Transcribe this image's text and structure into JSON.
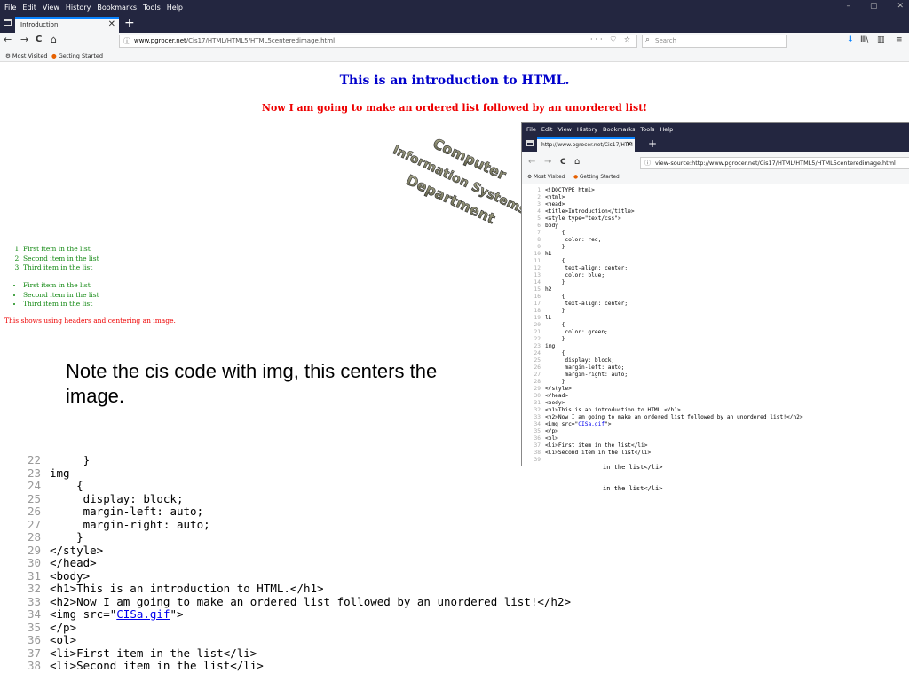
{
  "browser": {
    "menu": [
      "File",
      "Edit",
      "View",
      "History",
      "Bookmarks",
      "Tools",
      "Help"
    ],
    "window_controls": [
      "–",
      "▢",
      "✕"
    ],
    "tab": {
      "title": "Introduction",
      "close": "✕"
    },
    "new_tab": "+",
    "nav": {
      "back": "←",
      "forward": "→",
      "reload": "C",
      "home": "⌂"
    },
    "url_info_icon": "ⓘ",
    "url_domain": "www.pgrocer.net",
    "url_path": "/Cis17/HTML/HTML5/HTML5centeredimage.html",
    "url_actions": "··· ♡ ☆",
    "search_icon": "⌕",
    "search_placeholder": "Search",
    "toolbar_icons": {
      "download": "⬇",
      "library": "Ⅲ\\",
      "sidebar": "▥",
      "menu": "≡"
    },
    "bookmarks": [
      {
        "icon": "⚙",
        "label": "Most Visited"
      },
      {
        "icon": "●",
        "label": "Getting Started"
      }
    ]
  },
  "page": {
    "h1": "This is an introduction to HTML.",
    "h2": "Now I am going to make an ordered list followed by an unordered list!",
    "logo_text": [
      "Computer",
      "Information Systems",
      "Department"
    ],
    "ordered_list": [
      "First item in the list",
      "Second item in the list",
      "Third item in the list"
    ],
    "unordered_list": [
      "First item in the list",
      "Second item in the list",
      "Third item in the list"
    ],
    "paragraph": "This shows using headers and centering an image."
  },
  "note": "Note the cis code with img, this centers the image.",
  "source_window": {
    "menu": [
      "File",
      "Edit",
      "View",
      "History",
      "Bookmarks",
      "Tools",
      "Help"
    ],
    "tab": {
      "title": "http://www.pgrocer.net/Cis17/HTM",
      "close": "✕"
    },
    "new_tab": "+",
    "nav": {
      "back": "←",
      "forward": "→",
      "reload": "C",
      "home": "⌂"
    },
    "url_info_icon": "ⓘ",
    "url": "view-source:http://www.pgrocer.net/Cis17/HTML/HTML5/HTML5centeredimage.html",
    "bookmarks": [
      {
        "icon": "⚙",
        "label": "Most Visited"
      },
      {
        "icon": "●",
        "label": "Getting Started"
      }
    ],
    "lines": [
      {
        "n": "1",
        "t": "<!DOCTYPE html>"
      },
      {
        "n": "2",
        "t": "<html>"
      },
      {
        "n": "3",
        "t": "<head>"
      },
      {
        "n": "4",
        "t": "<title>Introduction</title>"
      },
      {
        "n": "5",
        "t": "<style type=\"text/css\">"
      },
      {
        "n": "6",
        "t": "body"
      },
      {
        "n": "7",
        "t": "     {"
      },
      {
        "n": "8",
        "t": "      color: red;"
      },
      {
        "n": "9",
        "t": "     }"
      },
      {
        "n": "10",
        "t": "h1"
      },
      {
        "n": "11",
        "t": "     {"
      },
      {
        "n": "12",
        "t": "      text-align: center;"
      },
      {
        "n": "13",
        "t": "      color: blue;"
      },
      {
        "n": "14",
        "t": "     }"
      },
      {
        "n": "15",
        "t": "h2"
      },
      {
        "n": "16",
        "t": "     {"
      },
      {
        "n": "17",
        "t": "      text-align: center;"
      },
      {
        "n": "18",
        "t": "     }"
      },
      {
        "n": "19",
        "t": "li"
      },
      {
        "n": "20",
        "t": "     {"
      },
      {
        "n": "21",
        "t": "      color: green;"
      },
      {
        "n": "22",
        "t": "     }"
      },
      {
        "n": "23",
        "t": "img"
      },
      {
        "n": "24",
        "t": "     {"
      },
      {
        "n": "25",
        "t": "      display: block;"
      },
      {
        "n": "26",
        "t": "      margin-left: auto;"
      },
      {
        "n": "27",
        "t": "      margin-right: auto;"
      },
      {
        "n": "28",
        "t": "     }"
      },
      {
        "n": "29",
        "t": "</style>"
      },
      {
        "n": "30",
        "t": "</head>"
      },
      {
        "n": "31",
        "t": "<body>"
      },
      {
        "n": "32",
        "t": "<h1>This is an introduction to HTML.</h1>"
      },
      {
        "n": "33",
        "t": "<h2>Now I am going to make an ordered list followed by an unordered list!</h2>"
      },
      {
        "n": "34",
        "t": "<img src=\"",
        "link": "CISa.gif",
        "after": "\">"
      },
      {
        "n": "35",
        "t": "</p>"
      },
      {
        "n": "36",
        "t": "<ol>"
      },
      {
        "n": "37",
        "t": "<li>First item in the list</li>"
      },
      {
        "n": "38",
        "t": "<li>Second item in the list</li>"
      },
      {
        "n": "39",
        "t": ""
      }
    ]
  },
  "overlap_fragments": [
    "in the list</li>",
    "in the list</li>"
  ],
  "code_listing": [
    {
      "n": "22",
      "t": "     }"
    },
    {
      "n": "23",
      "t": "img"
    },
    {
      "n": "24",
      "t": "    {"
    },
    {
      "n": "25",
      "t": "     display: block;"
    },
    {
      "n": "26",
      "t": "     margin-left: auto;"
    },
    {
      "n": "27",
      "t": "     margin-right: auto;"
    },
    {
      "n": "28",
      "t": "    }"
    },
    {
      "n": "29",
      "t": "</style>"
    },
    {
      "n": "30",
      "t": "</head>"
    },
    {
      "n": "31",
      "t": "<body>"
    },
    {
      "n": "32",
      "t": "<h1>This is an introduction to HTML.</h1>"
    },
    {
      "n": "33",
      "t": "<h2>Now I am going to make an ordered list followed by an unordered list!</h2>"
    },
    {
      "n": "34",
      "t": "<img src=\"",
      "link": "CISa.gif",
      "after": "\">"
    },
    {
      "n": "35",
      "t": "</p>"
    },
    {
      "n": "36",
      "t": "<ol>"
    },
    {
      "n": "37",
      "t": "<li>First item in the list</li>"
    },
    {
      "n": "38",
      "t": "<li>Second item in the list</li>"
    }
  ],
  "colors": {
    "chrome_dark": "#232640",
    "toolbar": "#f5f6f7",
    "h1": "#0000cc",
    "h2": "#ee0000",
    "list": "#118811",
    "link": "#0000ee"
  }
}
